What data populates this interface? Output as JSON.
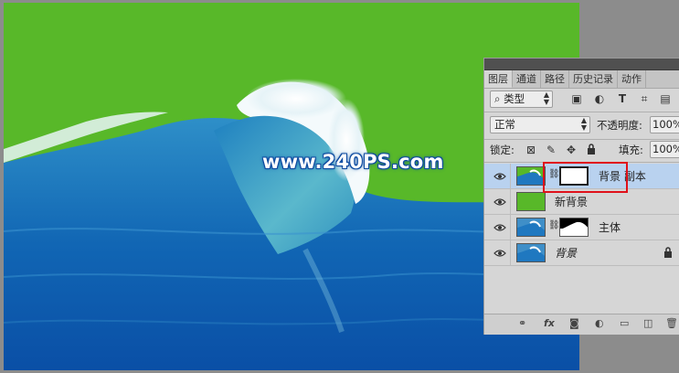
{
  "canvas": {
    "watermark_text": "www.240PS.com",
    "background_color": "#58b829"
  },
  "panel": {
    "tabs": [
      "图层",
      "通道",
      "路径",
      "历史记录",
      "动作"
    ],
    "active_tab": "图层",
    "filter_kind": "类型",
    "blend_mode": "正常",
    "opacity_label": "不透明度:",
    "opacity_value": "100%",
    "lock_label": "锁定:",
    "fill_label": "填充:",
    "fill_value": "100%",
    "layers": [
      {
        "name": "背景 副本",
        "thumb": "wave",
        "mask": "white",
        "selected": true,
        "visible": true
      },
      {
        "name": "新背景",
        "thumb": "green",
        "mask": null,
        "selected": false,
        "visible": true
      },
      {
        "name": "主体",
        "thumb": "wave",
        "mask": "black-with-white",
        "selected": false,
        "visible": true
      },
      {
        "name": "背景",
        "thumb": "wave",
        "mask": null,
        "selected": false,
        "visible": true,
        "italic": true,
        "locked": true
      }
    ],
    "bottom_icons": [
      "link-icon",
      "fx-icon",
      "mask-icon",
      "adjustment-icon",
      "folder-icon",
      "new-layer-icon",
      "trash-icon"
    ]
  },
  "icons": {
    "search": "⌕",
    "updown": "⇕",
    "pixel": "▣",
    "adjust": "◐",
    "text": "T",
    "transform": "⌗",
    "smart": "▤",
    "lock_transparent": "⊠",
    "lock_paint": "✎",
    "lock_move": "✥",
    "lock_all": "🔒",
    "chain": "⛓"
  }
}
